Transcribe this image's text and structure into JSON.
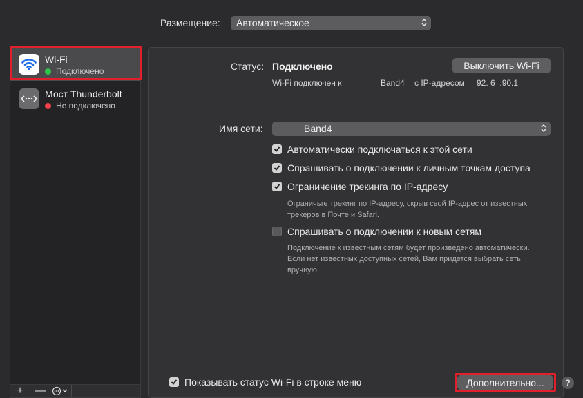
{
  "location": {
    "label": "Размещение:",
    "value": "Автоматическое"
  },
  "sidebar": {
    "services": [
      {
        "name": "Wi-Fi",
        "status": "Подключено",
        "status_color": "#2fc44a",
        "icon": "wifi-icon",
        "selected": true
      },
      {
        "name": "Мост Thunderbolt",
        "status": "Не подключено",
        "status_color": "#f0424a",
        "icon": "thunderbolt-bridge-icon",
        "selected": false
      }
    ],
    "toolbar": {
      "add": "+",
      "remove": "—"
    }
  },
  "status": {
    "label": "Статус:",
    "value": "Подключено",
    "detail_prefix": "Wi-Fi подключен к",
    "network": "Band4",
    "ip_prefix": "с IP-адресом",
    "ip": "92. 6  .90.1",
    "toggle_button": "Выключить Wi-Fi"
  },
  "network": {
    "label": "Имя сети:",
    "value": "Band4"
  },
  "options": [
    {
      "label": "Автоматически подключаться к этой сети",
      "checked": true
    },
    {
      "label": "Спрашивать о подключении к личным точкам доступа",
      "checked": true
    },
    {
      "label": "Ограничение трекинга по IP-адресу",
      "checked": true,
      "note": [
        "Ограничьте трекинг по IP-адресу, скрыв свой IP-адрес от известных",
        "трекеров в Почте и Safari."
      ]
    },
    {
      "label": "Спрашивать о подключении к новым сетям",
      "checked": false,
      "note": [
        "Подключение к известным сетям будет произведено автоматически.",
        "Если нет известных доступных сетей, Вам придется выбрать сеть",
        "вручную."
      ]
    }
  ],
  "footer": {
    "show_status_label": "Показывать статус Wi-Fi в строке меню",
    "show_status_checked": true,
    "advanced_button": "Дополнительно...",
    "help": "?"
  },
  "colors": {
    "highlight": "#e0202a",
    "wifi_icon_bg": "#ffffff",
    "wifi_icon_fg": "#1e6fe8"
  }
}
